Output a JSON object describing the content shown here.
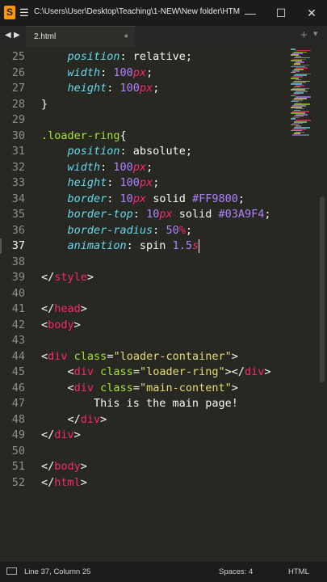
{
  "titlebar": {
    "app_icon": "S",
    "menu_icon": "hamburger-icon",
    "title": "C:\\Users\\User\\Desktop\\Teaching\\1-NEW\\New folder\\HTM...",
    "minimize": "—",
    "maximize": "☐",
    "close": "✕"
  },
  "tabbar": {
    "back": "◀",
    "forward": "▶",
    "tab_label": "2.html",
    "tab_close": "●",
    "add": "+",
    "more": "▾"
  },
  "editor": {
    "active_line": "37",
    "line_numbers": [
      "25",
      "26",
      "27",
      "28",
      "29",
      "30",
      "31",
      "32",
      "33",
      "34",
      "35",
      "36",
      "37",
      "38",
      "39",
      "40",
      "41",
      "42",
      "43",
      "44",
      "45",
      "46",
      "47",
      "48",
      "49",
      "50",
      "51",
      "52"
    ],
    "lines": [
      [
        {
          "k": "p",
          "t": "    position"
        },
        {
          "k": "w",
          "t": ": relative;"
        }
      ],
      [
        {
          "k": "p",
          "t": "    width"
        },
        {
          "k": "w",
          "t": ": "
        },
        {
          "k": "n",
          "t": "100"
        },
        {
          "k": "u",
          "t": "px"
        },
        {
          "k": "w",
          "t": ";"
        }
      ],
      [
        {
          "k": "p",
          "t": "    height"
        },
        {
          "k": "w",
          "t": ": "
        },
        {
          "k": "n",
          "t": "100"
        },
        {
          "k": "u",
          "t": "px"
        },
        {
          "k": "w",
          "t": ";"
        }
      ],
      [
        {
          "k": "w",
          "t": "}"
        }
      ],
      [],
      [
        {
          "k": "c",
          "t": ".loader-ring"
        },
        {
          "k": "w",
          "t": "{"
        }
      ],
      [
        {
          "k": "p",
          "t": "    position"
        },
        {
          "k": "w",
          "t": ": absolute;"
        }
      ],
      [
        {
          "k": "p",
          "t": "    width"
        },
        {
          "k": "w",
          "t": ": "
        },
        {
          "k": "n",
          "t": "100"
        },
        {
          "k": "u",
          "t": "px"
        },
        {
          "k": "w",
          "t": ";"
        }
      ],
      [
        {
          "k": "p",
          "t": "    height"
        },
        {
          "k": "w",
          "t": ": "
        },
        {
          "k": "n",
          "t": "100"
        },
        {
          "k": "u",
          "t": "px"
        },
        {
          "k": "w",
          "t": ";"
        }
      ],
      [
        {
          "k": "p",
          "t": "    border"
        },
        {
          "k": "w",
          "t": ": "
        },
        {
          "k": "n",
          "t": "10"
        },
        {
          "k": "u",
          "t": "px"
        },
        {
          "k": "w",
          "t": " solid "
        },
        {
          "k": "n",
          "t": "#FF9800"
        },
        {
          "k": "w",
          "t": ";"
        }
      ],
      [
        {
          "k": "p",
          "t": "    border-top"
        },
        {
          "k": "w",
          "t": ": "
        },
        {
          "k": "n",
          "t": "10"
        },
        {
          "k": "u",
          "t": "px"
        },
        {
          "k": "w",
          "t": " solid "
        },
        {
          "k": "n",
          "t": "#03A9F4"
        },
        {
          "k": "w",
          "t": ";"
        }
      ],
      [
        {
          "k": "p",
          "t": "    border-radius"
        },
        {
          "k": "w",
          "t": ": "
        },
        {
          "k": "n",
          "t": "50"
        },
        {
          "k": "u",
          "t": "%"
        },
        {
          "k": "w",
          "t": ";"
        }
      ],
      [
        {
          "k": "p",
          "t": "    animation"
        },
        {
          "k": "w",
          "t": ": spin "
        },
        {
          "k": "n",
          "t": "1.5"
        },
        {
          "k": "u",
          "t": "s"
        }
      ],
      [],
      [
        {
          "k": "w",
          "t": "</"
        },
        {
          "k": "t",
          "t": "style"
        },
        {
          "k": "w",
          "t": ">"
        }
      ],
      [],
      [
        {
          "k": "w",
          "t": "</"
        },
        {
          "k": "t",
          "t": "head"
        },
        {
          "k": "w",
          "t": ">"
        }
      ],
      [
        {
          "k": "w",
          "t": "<"
        },
        {
          "k": "t",
          "t": "body"
        },
        {
          "k": "w",
          "t": ">"
        }
      ],
      [],
      [
        {
          "k": "w",
          "t": "<"
        },
        {
          "k": "t",
          "t": "div"
        },
        {
          "k": "w",
          "t": " "
        },
        {
          "k": "c",
          "t": "class"
        },
        {
          "k": "w",
          "t": "="
        },
        {
          "k": "s",
          "t": "\"loader-container\""
        },
        {
          "k": "w",
          "t": ">"
        }
      ],
      [
        {
          "k": "w",
          "t": "    <"
        },
        {
          "k": "t",
          "t": "div"
        },
        {
          "k": "w",
          "t": " "
        },
        {
          "k": "c",
          "t": "class"
        },
        {
          "k": "w",
          "t": "="
        },
        {
          "k": "s",
          "t": "\"loader-ring\""
        },
        {
          "k": "w",
          "t": "></"
        },
        {
          "k": "t",
          "t": "div"
        },
        {
          "k": "w",
          "t": ">"
        }
      ],
      [
        {
          "k": "w",
          "t": "    <"
        },
        {
          "k": "t",
          "t": "div"
        },
        {
          "k": "w",
          "t": " "
        },
        {
          "k": "c",
          "t": "class"
        },
        {
          "k": "w",
          "t": "="
        },
        {
          "k": "s",
          "t": "\"main-content\""
        },
        {
          "k": "w",
          "t": ">"
        }
      ],
      [
        {
          "k": "w",
          "t": "        This is the main page!"
        }
      ],
      [
        {
          "k": "w",
          "t": "    </"
        },
        {
          "k": "t",
          "t": "div"
        },
        {
          "k": "w",
          "t": ">"
        }
      ],
      [
        {
          "k": "w",
          "t": "</"
        },
        {
          "k": "t",
          "t": "div"
        },
        {
          "k": "w",
          "t": ">"
        }
      ],
      [],
      [
        {
          "k": "w",
          "t": "</"
        },
        {
          "k": "t",
          "t": "body"
        },
        {
          "k": "w",
          "t": ">"
        }
      ],
      [
        {
          "k": "w",
          "t": "</"
        },
        {
          "k": "t",
          "t": "html"
        },
        {
          "k": "w",
          "t": ">"
        }
      ]
    ]
  },
  "statusbar": {
    "position": "Line 37, Column 25",
    "spaces": "Spaces: 4",
    "syntax": "HTML"
  },
  "colors": {
    "background": "#272822",
    "property": "#66d9ef",
    "number": "#ae81ff",
    "tag": "#f92672",
    "string": "#e6db74",
    "selector": "#a6e22e",
    "text": "#f8f8f2"
  }
}
